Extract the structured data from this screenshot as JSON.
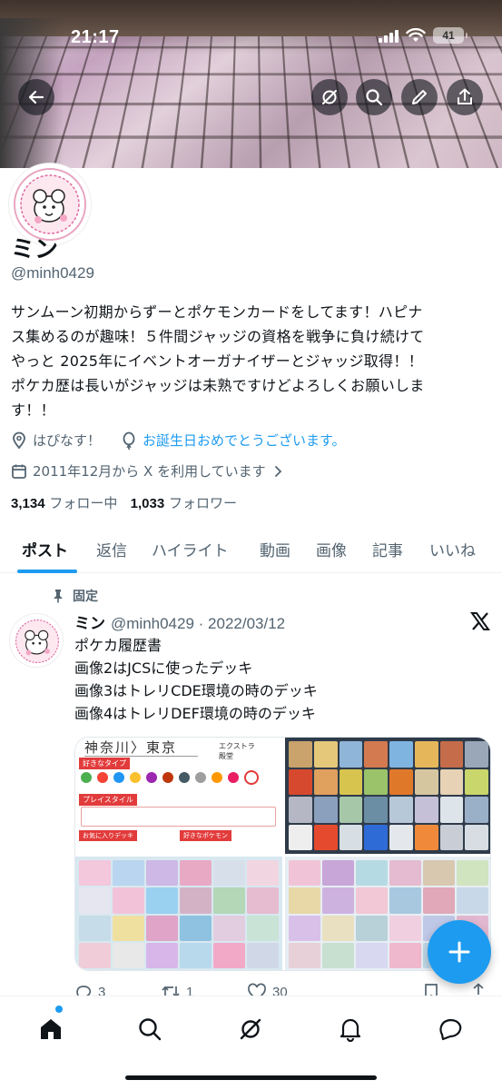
{
  "status_bar": {
    "time": "21:17",
    "battery": "41"
  },
  "profile": {
    "name": "ミン",
    "handle": "@minh0429",
    "bio_lines": [
      "サンムーン初期からずーとポケモンカードをしてます！ハピナ",
      "ス集めるのが趣味！５件間ジャッジの資格を戦争に負け続けて",
      "やっと 2025年にイベントオーガナイザーとジャッジ取得！！",
      "ポケカ歴は長いがジャッジは未熟ですけどよろしくお願いしま",
      "す！！"
    ],
    "location": "はぴなす！",
    "birthday": "お誕生日おめでとうございます。",
    "joined": "2011年12月から X を利用しています",
    "following_count": "3,134",
    "following_label": "フォロー中",
    "followers_count": "1,033",
    "followers_label": "フォロワー"
  },
  "tabs": [
    "ポスト",
    "返信",
    "ハイライト",
    "動画",
    "画像",
    "記事",
    "いいね"
  ],
  "post": {
    "pinned_label": "固定",
    "author": "ミン",
    "handle_date": "@minh0429 · 2022/03/12",
    "text_lines": [
      "ポケカ履歴書",
      "画像2はJCSに使ったデッキ",
      "画像3はトレリCDE環境の時のデッキ",
      "画像4はトレリDEF環境の時のデッキ"
    ],
    "media1": {
      "region": "神奈川〉東京",
      "label1": "好きなタイプ",
      "label2": "プレイスタイル",
      "label3": "お気に入りデッキ",
      "label4": "好きなポケモン",
      "tag1": "エクストラ",
      "tag2": "殿堂"
    },
    "replies": "3",
    "reposts": "1",
    "likes": "30"
  },
  "colors": {
    "accent": "#1d9bf0",
    "text": "#0f1419",
    "muted": "#536471"
  }
}
